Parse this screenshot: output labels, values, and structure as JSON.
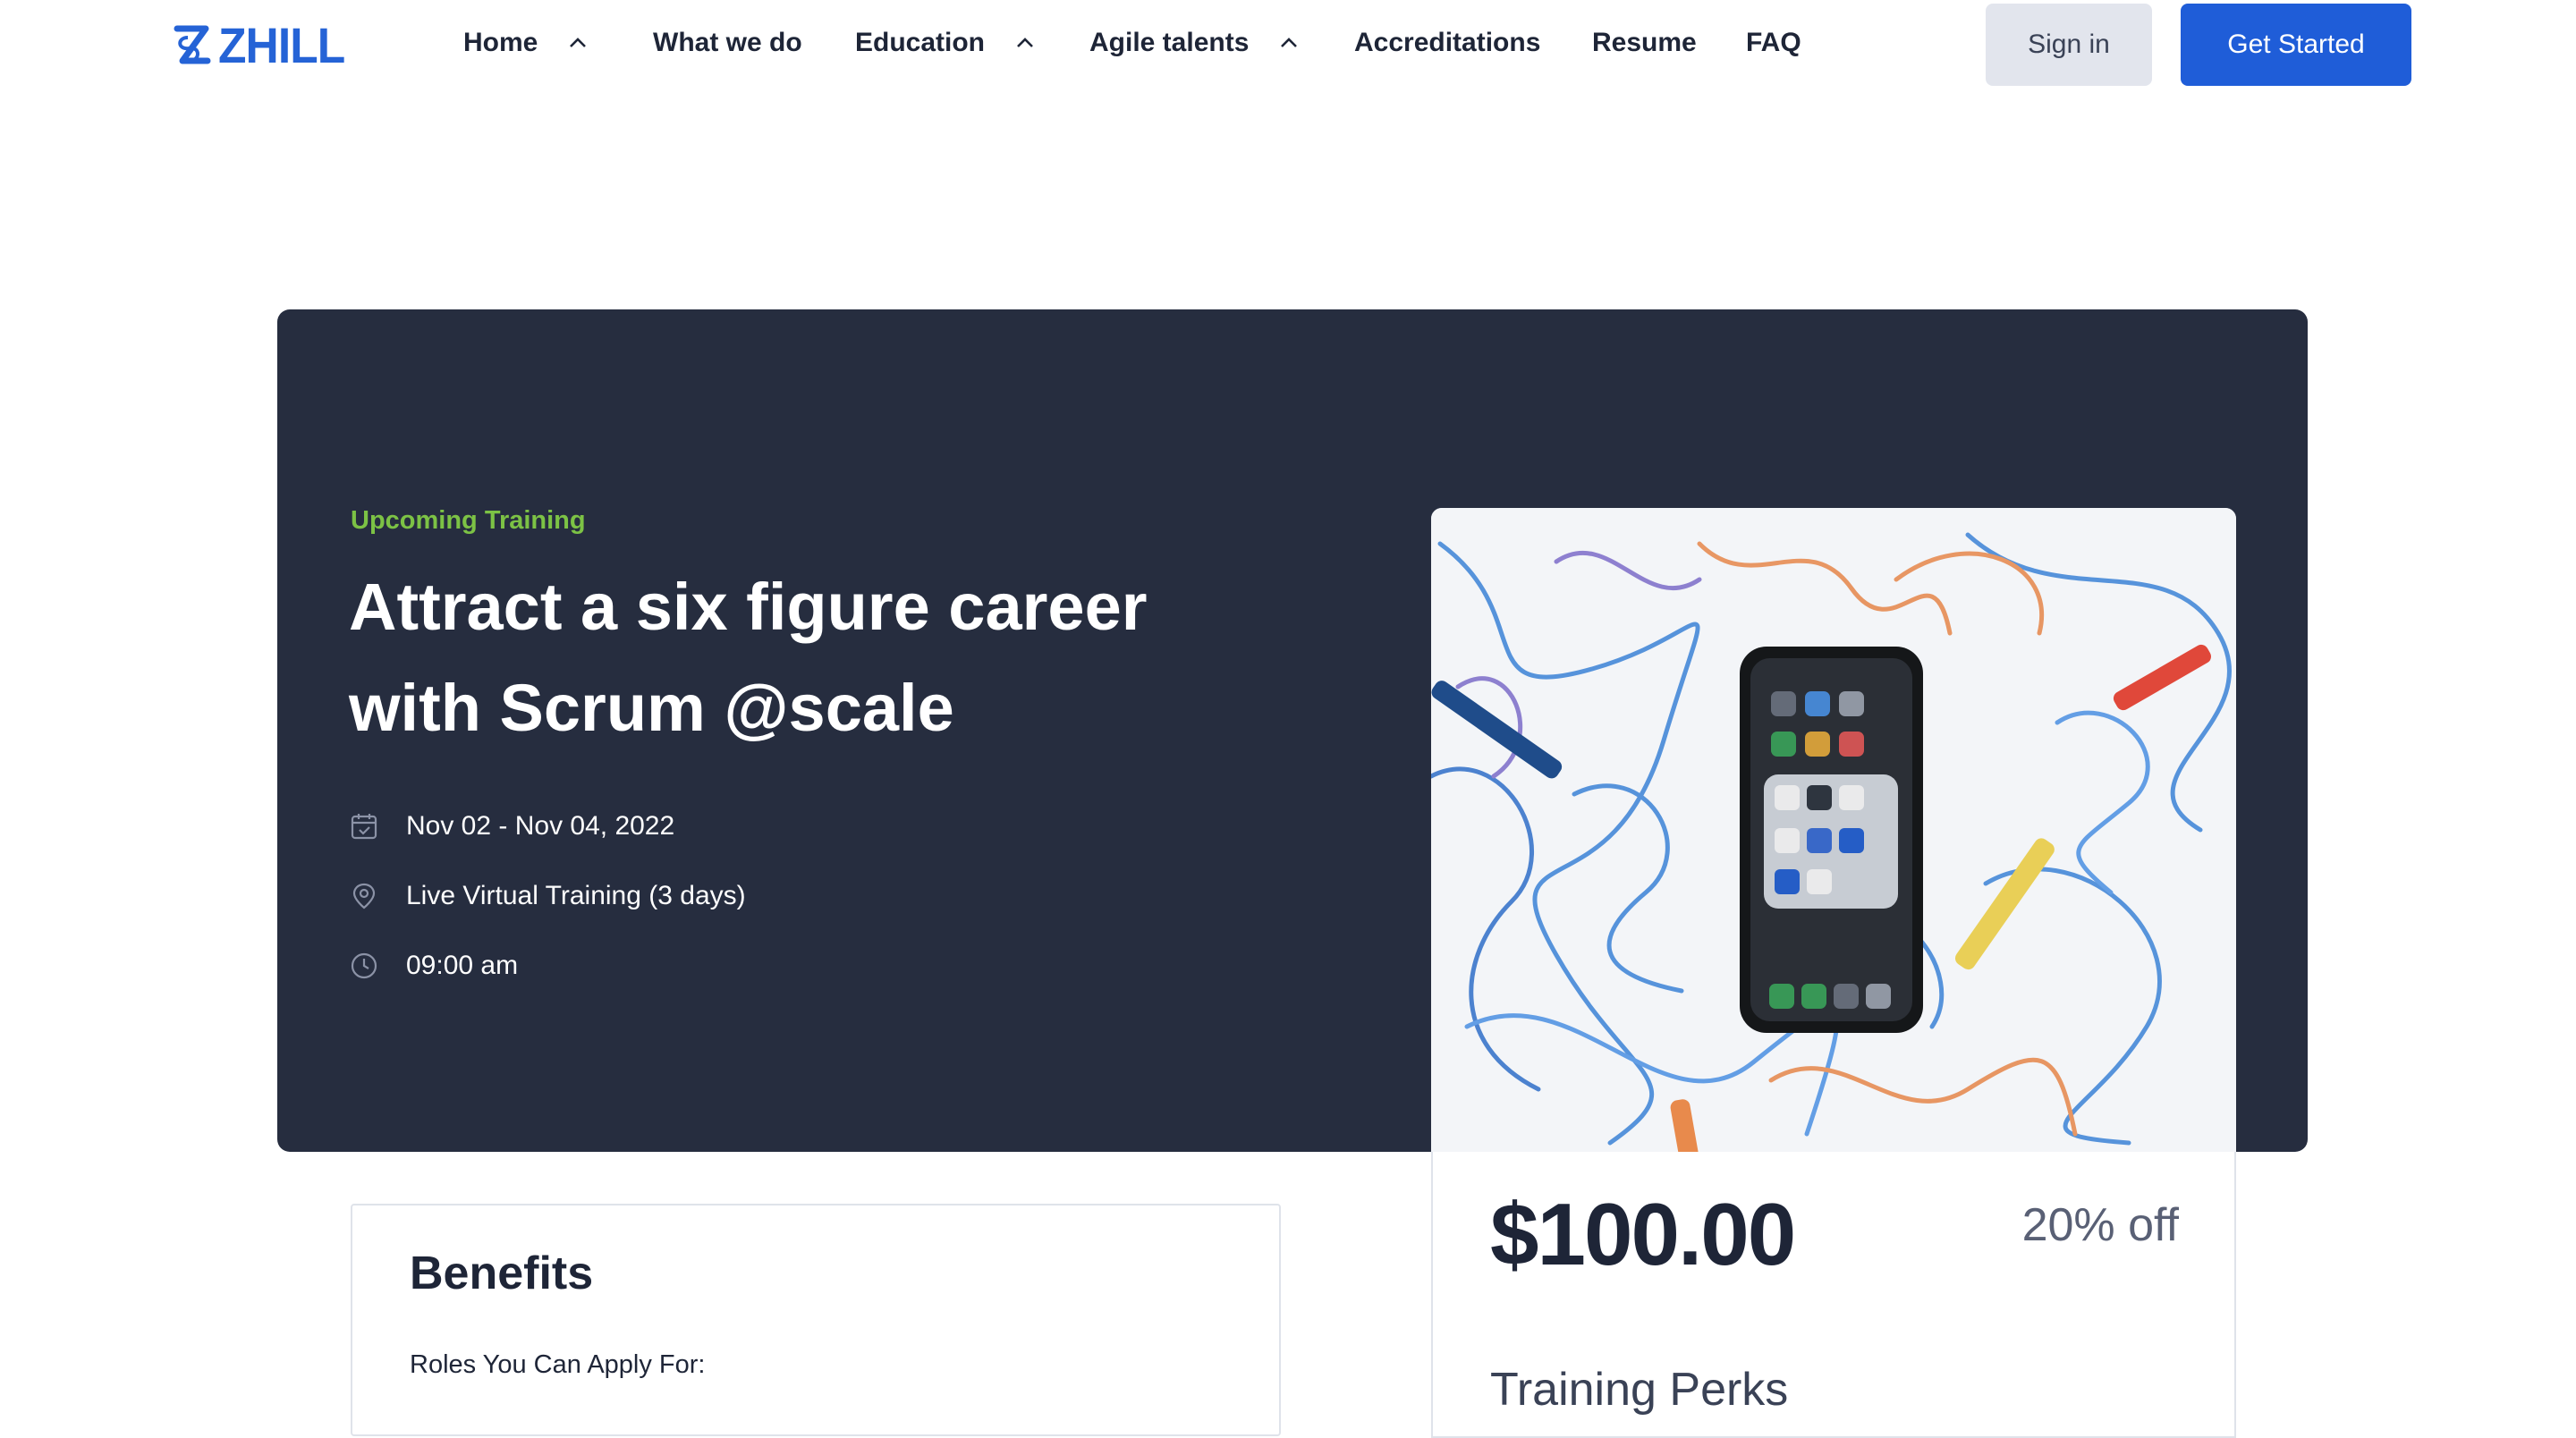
{
  "brand": {
    "name": "ZHILL",
    "color": "#2563d6"
  },
  "nav": {
    "items": [
      {
        "label": "Home",
        "has_dropdown": true
      },
      {
        "label": "What we do",
        "has_dropdown": false
      },
      {
        "label": "Education",
        "has_dropdown": true
      },
      {
        "label": "Agile talents",
        "has_dropdown": true
      },
      {
        "label": "Accreditations",
        "has_dropdown": false
      },
      {
        "label": "Resume",
        "has_dropdown": false
      },
      {
        "label": "FAQ",
        "has_dropdown": false
      }
    ],
    "signin_label": "Sign in",
    "get_started_label": "Get Started"
  },
  "hero": {
    "eyebrow": "Upcoming Training",
    "title_line1": "Attract a six figure career",
    "title_line2": "with Scrum @scale",
    "date_range": "Nov 02 - Nov 04, 2022",
    "format": "Live Virtual Training (3 days)",
    "time": "09:00 am",
    "icons": {
      "date": "calendar-icon",
      "format": "location-pin-icon",
      "time": "clock-icon"
    },
    "colors": {
      "background": "#262d3f",
      "eyebrow": "#7cc245"
    }
  },
  "benefits": {
    "title": "Benefits",
    "roles_heading": "Roles You Can Apply For:"
  },
  "pricing": {
    "price": "$100.00",
    "discount": "20% off",
    "perks_heading": "Training Perks"
  },
  "accent_color": "#1f5dd8"
}
